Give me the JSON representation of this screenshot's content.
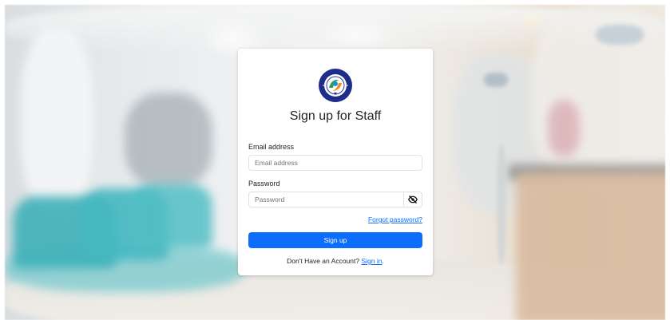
{
  "logo": {
    "icon": "organization-seal-logo",
    "colors": {
      "ring": "#1f2d8a",
      "inner": "#ffffff",
      "accent_green": "#2e9e4f",
      "accent_orange": "#f08c1d"
    }
  },
  "form": {
    "title": "Sign up for Staff",
    "email": {
      "label": "Email address",
      "placeholder": "Email address",
      "value": ""
    },
    "password": {
      "label": "Password",
      "placeholder": "Password",
      "value": "",
      "toggle_icon": "eye-slash-icon"
    },
    "forgot_password": "Forgot password?",
    "submit_label": "Sign up",
    "footer": {
      "text": "Don't Have an Account?",
      "link": "Sign in",
      "trailing": "."
    }
  },
  "colors": {
    "primary": "#0d6efd",
    "text": "#212529",
    "muted": "#6c757d",
    "border": "#dee2e6",
    "card_bg": "#ffffff"
  }
}
